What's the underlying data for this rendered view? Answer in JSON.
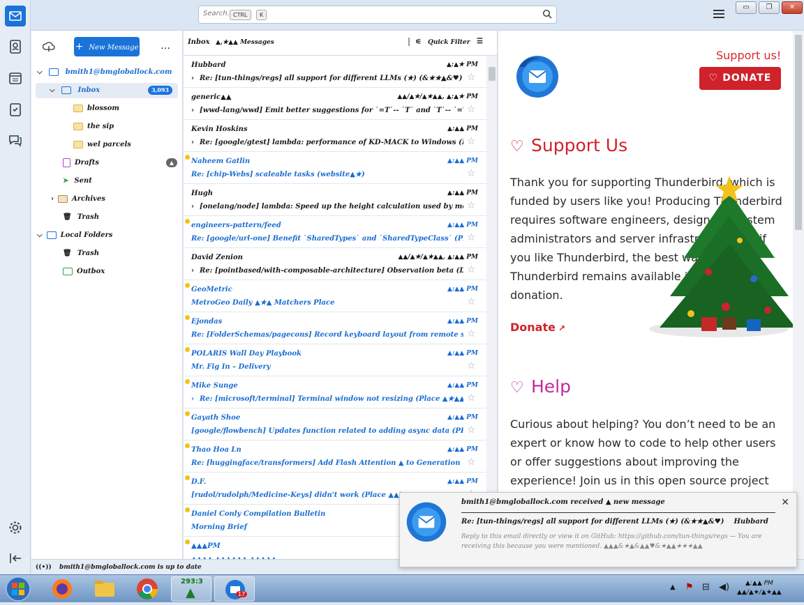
{
  "search": {
    "placeholder": "Search...",
    "key1": "CTRL",
    "key2": "K"
  },
  "window_controls": {
    "minimize": "▭",
    "maximize": "❐",
    "close": "✕"
  },
  "folder_pane": {
    "new_message_label": "New Message",
    "more_label": "…",
    "account": "bmith1@bmgloballock.com",
    "inbox": {
      "label": "Inbox",
      "count": "3,093"
    },
    "subfolders": [
      "blossom",
      "the sip",
      "wel parcels"
    ],
    "drafts": {
      "label": "Drafts",
      "count": "▲"
    },
    "sent": "Sent",
    "archives": "Archives",
    "trash": "Trash",
    "local_folders": "Local Folders",
    "local_trash": "Trash",
    "outbox": "Outbox"
  },
  "message_list": {
    "header_title": "Inbox",
    "header_count": "▲,★▲▲ Messages",
    "quick_filter": "Quick Filter",
    "messages": [
      {
        "sender": "Hubbard",
        "date": "▲:▲★ PM",
        "subject": "Re: [tun-things/regs] all support for different LLMs (★) (&★★▲&♥)",
        "unread": false,
        "thread": true
      },
      {
        "sender": "generic▲▲",
        "date": "▲▲/▲★/▲★▲▲, ▲:▲★ PM",
        "subject": "[wwd-lang/wwd] Emit better suggestions for `=T`-- `T` and `T`-- `=T` (PR_▲▲★▲▲▲)",
        "unread": false,
        "thread": true
      },
      {
        "sender": "Kevin Hoskins",
        "date": "▲:▲▲ PM",
        "subject": "Re: [google/gtest] lambda: performance of KD-MACK to Windows (Place ♥★★★)",
        "unread": false,
        "thread": true
      },
      {
        "sender": "Naheem Gatlin",
        "date": "▲:▲▲ PM",
        "subject": "Re: [chip-Webs] scaleable tasks (website▲★)",
        "unread": true,
        "thread": false
      },
      {
        "sender": "Hugh",
        "date": "▲:▲▲ PM",
        "subject": "[onelang/node] lambda: Speed up the height calculation used by mobile/Providers (PR_▲★♥▲)",
        "unread": false,
        "thread": true
      },
      {
        "sender": "engineers-pattern/feed",
        "date": "▲:▲▲ PM",
        "subject": "Re: [google/url-one] Benefit `SharedTypes` and `SharedTypeClass` (PR_▲▲▲)",
        "unread": true,
        "thread": false
      },
      {
        "sender": "David Zenion",
        "date": "▲▲/▲★/▲★▲▲, ▲:▲▲ PM",
        "subject": "Re: [pointbased/with-composable-architecture] Observation beta (Discussion_★▲♥▲)",
        "unread": false,
        "thread": true
      },
      {
        "sender": "GeoMetric",
        "date": "▲:▲▲ PM",
        "subject": "MetroGeo Daily ▲★▲ Matchers Place",
        "unread": true,
        "thread": false
      },
      {
        "sender": "Ejondas",
        "date": "▲:▲▲ PM",
        "subject": "Re: [FolderSchemas/pagecons] Record keyboard layout from remote session to native mode (▲★▲…",
        "unread": true,
        "thread": false
      },
      {
        "sender": "POLARIS Wall Day Playbook",
        "date": "▲:▲▲ PM",
        "subject": "Mr. Fig In – Delivery",
        "unread": true,
        "thread": false
      },
      {
        "sender": "Mike Sunge",
        "date": "▲:▲▲ PM",
        "subject": "Re: [microsoft/terminal] Terminal window not resizing (Place ▲★▲▲▲)",
        "unread": true,
        "thread": true
      },
      {
        "sender": "Gayath Shoe",
        "date": "▲:▲▲ PM",
        "subject": "[google/flowbench] Updates function related to adding async data (PR_▲★▲)",
        "unread": true,
        "thread": false
      },
      {
        "sender": "Thao Hoa Ln",
        "date": "▲:▲▲ PM",
        "subject": "Re: [huggingface/transformers] Add Flash Attention ▲ to Generation (PR_▲★▲★▲)",
        "unread": true,
        "thread": false
      },
      {
        "sender": "D.F.",
        "date": "▲:▲▲ PM",
        "subject": "[rudol/rudolph/Medicine-Keys] didn't work (Place ▲▲)",
        "unread": true,
        "thread": false
      },
      {
        "sender": "Daniel Conly Compilation Bulletin",
        "date": "▲:▲▲ PM",
        "subject": "Morning Brief",
        "unread": true,
        "thread": false
      },
      {
        "sender": "▲▲▲PM",
        "date": "▲:▲▲ PM",
        "subject": "▲▲▲▲ ▲▲▲▲▲▲ ▲▲▲▲▲",
        "unread": true,
        "thread": false
      }
    ]
  },
  "content": {
    "support_link": "Support us!",
    "donate_button": "DONATE",
    "support_heading": "Support Us",
    "support_text": "Thank you for supporting Thunderbird, which is funded by users like you! Producing Thunderbird requires software engineers, designers, system administrators and server infrastructure. So if you like Thunderbird, the best way to ensure Thunderbird remains available is to make a donation.",
    "donate_link": "Donate",
    "help_heading": "Help",
    "help_text": "Curious about helping? You don’t need to be an expert or know how to code to help other users or offer suggestions about improving the experience! Join us in this open source project"
  },
  "status_bar": {
    "text": "bmith1@bmgloballock.com is up to date"
  },
  "notification": {
    "title": "bmith1@bmgloballock.com received ▲ new message",
    "subject": "Re: [tun-things/regs] all support for different LLMs (★) (&★★▲&♥)",
    "sender": "Hubbard",
    "body": "Reply to this email directly or view it on GitHub: https://github.com/tun-things/regs — You are receiving this because you were mentioned. ▲▲▲&★▲&▲▲♥&★▲▲★★★▲▲"
  },
  "taskbar": {
    "weather_value": "293:3",
    "badge": "17",
    "clock_time": "▲:▲▲ PM",
    "clock_date": "▲▲/▲★/▲★▲▲"
  },
  "colors": {
    "accent": "#1a73d9",
    "donate_red": "#d0222a",
    "help_purple": "#c2299f",
    "unread_blue": "#1a6dd0"
  }
}
